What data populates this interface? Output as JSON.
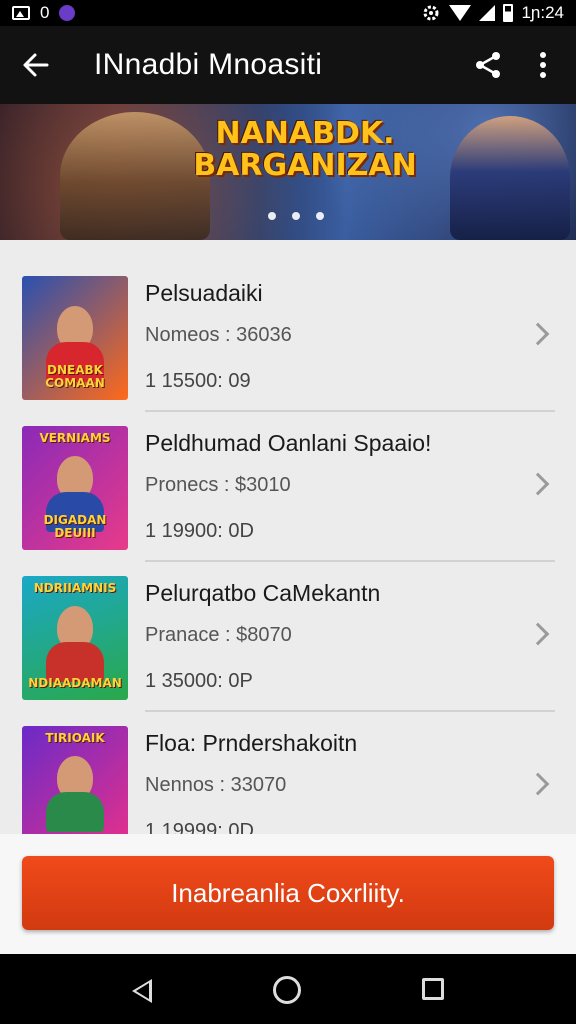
{
  "status_bar": {
    "left_text": "0",
    "time": "1ɲ:24"
  },
  "app_bar": {
    "title": "INnadbi Mnoasiti"
  },
  "banner": {
    "title": "NANABDK. BARGANIZAN"
  },
  "items": [
    {
      "title": "Pelsuadaiki",
      "subtitle": "Nomeos : 36036",
      "price": "1  15500: 09",
      "thumb_top": "",
      "thumb_label": "DNEABK COMAAN",
      "colors": {
        "bg1": "#2a50b0",
        "bg2": "#ff6a1a",
        "body": "#d8262e"
      }
    },
    {
      "title": "Peldhumad Oanlani Spaaio!",
      "subtitle": "Pronecs : $3010",
      "price": "1  19900: 0D",
      "thumb_top": "VERNIAMS",
      "thumb_label": "DIGADAN DEUIII",
      "colors": {
        "bg1": "#8a2ab8",
        "bg2": "#e83a8a",
        "body": "#2a4aa8"
      }
    },
    {
      "title": "Pelurqatbo CaMekantn",
      "subtitle": "Pranace : $8070",
      "price": "1  35000: 0P",
      "thumb_top": "NDRIIAMNIS",
      "thumb_label": "NDIAADAMAN",
      "colors": {
        "bg1": "#1aa8c8",
        "bg2": "#2aa84a",
        "body": "#c8302a"
      }
    },
    {
      "title": "Floa: Prndershakoitn",
      "subtitle": "Nennos : 33070",
      "price": "1  19999: 0D",
      "thumb_top": "TIRIOAIK",
      "thumb_label": "",
      "colors": {
        "bg1": "#6a2ac8",
        "bg2": "#e8308a",
        "body": "#2a8a4a"
      }
    }
  ],
  "cta": {
    "label": "Inabreanlia Coxrliity."
  },
  "icons": {
    "status": [
      "gallery-icon",
      "app-notification-icon",
      "settings-gear-icon",
      "wifi-icon",
      "signal-icon",
      "battery-icon"
    ],
    "app_bar": [
      "back-arrow-icon",
      "share-icon",
      "more-vert-icon"
    ],
    "nav": [
      "nav-back-icon",
      "nav-home-icon",
      "nav-recent-icon"
    ]
  },
  "accent": "#e0421a"
}
